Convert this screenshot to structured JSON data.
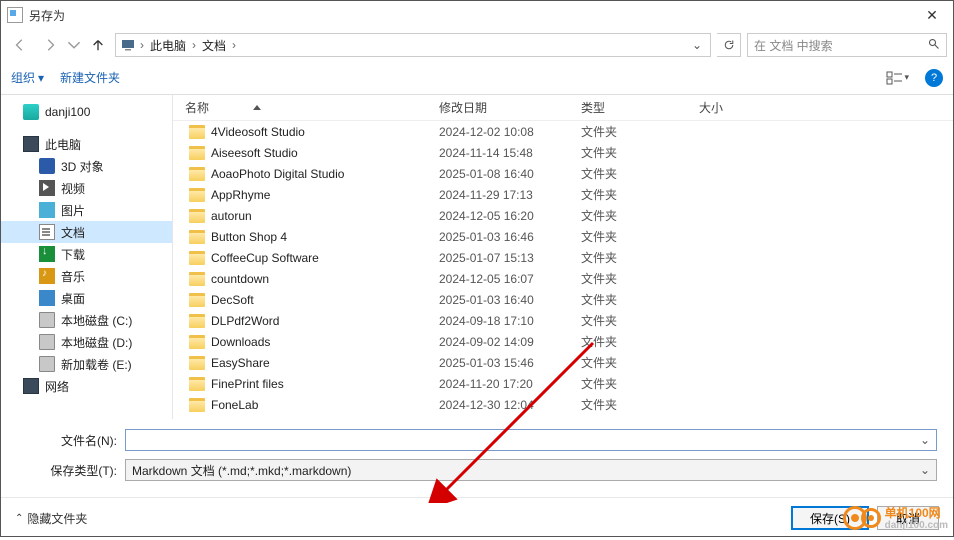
{
  "window": {
    "title": "另存为"
  },
  "nav": {
    "breadcrumb": [
      "此电脑",
      "文档"
    ],
    "refresh_drop": "⌄",
    "search_placeholder": "在 文档 中搜索"
  },
  "toolbar": {
    "organize": "组织",
    "new_folder": "新建文件夹"
  },
  "sidebar": {
    "items": [
      {
        "label": "danji100",
        "icon": "ic-folder",
        "sub": false
      },
      {
        "label": "此电脑",
        "icon": "ic-pc",
        "sub": false
      },
      {
        "label": "3D 对象",
        "icon": "ic-3d",
        "sub": true
      },
      {
        "label": "视频",
        "icon": "ic-vid",
        "sub": true
      },
      {
        "label": "图片",
        "icon": "ic-pic",
        "sub": true
      },
      {
        "label": "文档",
        "icon": "ic-doc",
        "sub": true,
        "sel": true
      },
      {
        "label": "下载",
        "icon": "ic-dl",
        "sub": true
      },
      {
        "label": "音乐",
        "icon": "ic-music",
        "sub": true
      },
      {
        "label": "桌面",
        "icon": "ic-desk",
        "sub": true
      },
      {
        "label": "本地磁盘 (C:)",
        "icon": "ic-disk",
        "sub": true
      },
      {
        "label": "本地磁盘 (D:)",
        "icon": "ic-disk",
        "sub": true
      },
      {
        "label": "新加载卷 (E:)",
        "icon": "ic-disk",
        "sub": true
      },
      {
        "label": "网络",
        "icon": "ic-pc",
        "sub": false
      }
    ]
  },
  "columns": {
    "name": "名称",
    "date": "修改日期",
    "type": "类型",
    "size": "大小"
  },
  "type_folder": "文件夹",
  "files": [
    {
      "name": "4Videosoft Studio",
      "date": "2024-12-02 10:08"
    },
    {
      "name": "Aiseesoft Studio",
      "date": "2024-11-14 15:48"
    },
    {
      "name": "AoaoPhoto Digital Studio",
      "date": "2025-01-08 16:40"
    },
    {
      "name": "AppRhyme",
      "date": "2024-11-29 17:13"
    },
    {
      "name": "autorun",
      "date": "2024-12-05 16:20"
    },
    {
      "name": "Button Shop 4",
      "date": "2025-01-03 16:46"
    },
    {
      "name": "CoffeeCup Software",
      "date": "2025-01-07 15:13"
    },
    {
      "name": "countdown",
      "date": "2024-12-05 16:07"
    },
    {
      "name": "DecSoft",
      "date": "2025-01-03 16:40"
    },
    {
      "name": "DLPdf2Word",
      "date": "2024-09-18 17:10"
    },
    {
      "name": "Downloads",
      "date": "2024-09-02 14:09"
    },
    {
      "name": "EasyShare",
      "date": "2025-01-03 15:46"
    },
    {
      "name": "FinePrint files",
      "date": "2024-11-20 17:20"
    },
    {
      "name": "FoneLab",
      "date": "2024-12-30 12:04"
    }
  ],
  "fields": {
    "filename_label": "文件名(N):",
    "filename_value": "",
    "filetype_label": "保存类型(T):",
    "filetype_value": "Markdown 文档 (*.md;*.mkd;*.markdown)"
  },
  "footer": {
    "hide": "隐藏文件夹",
    "save": "保存(S)",
    "cancel": "取消"
  },
  "watermark": {
    "brand": "单机100网",
    "url": "danji100.com"
  }
}
